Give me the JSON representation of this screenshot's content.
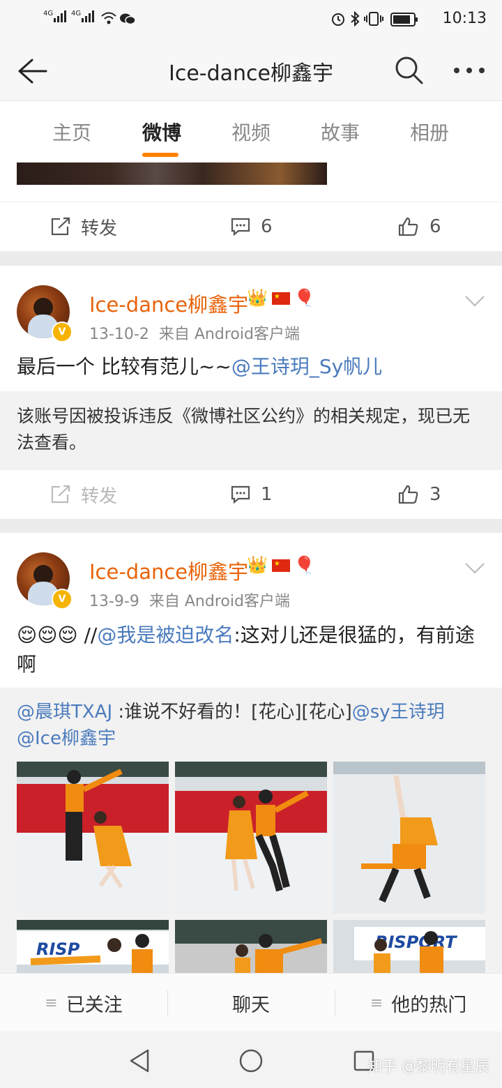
{
  "status_bar": {
    "signal_1": "4G",
    "signal_2": "4G",
    "time": "10:13"
  },
  "nav": {
    "title": "Ice-dance柳鑫宇"
  },
  "tabs": [
    {
      "label": "主页"
    },
    {
      "label": "微博"
    },
    {
      "label": "视频"
    },
    {
      "label": "故事"
    },
    {
      "label": "相册"
    }
  ],
  "active_tab": "微博",
  "accent_color": "#ff8200",
  "post0": {
    "repost_label": "转发",
    "comments": "6",
    "likes": "6"
  },
  "post1": {
    "user": "Ice-dance柳鑫宇",
    "date": "13-10-2",
    "source": "来自 Android客户端",
    "text": "最后一个 比较有范儿~~",
    "mention": "@王诗玥_Sy帆儿",
    "repost_notice": "该账号因被投诉违反《微博社区公约》的相关规定，现已无法查看。",
    "repost_label": "转发",
    "comments": "1",
    "likes": "3"
  },
  "post2": {
    "user": "Ice-dance柳鑫宇",
    "date": "13-9-9",
    "source": "来自 Android客户端",
    "emojis": "😌😌😌",
    "text_prefix": " //",
    "mention": "@我是被迫改名",
    "text": ":这对儿还是很猛的，有前途啊",
    "repost_mention": "@晨琪TXAJ",
    "repost_text": " :谁说不好看的！[花心][花心]",
    "repost_mention_2": "@sy王诗玥",
    "repost_mention_3": "@Ice柳鑫宇",
    "photos": [
      "figure-skating-photo-1",
      "figure-skating-photo-2",
      "figure-skating-photo-3",
      "figure-skating-photo-4",
      "figure-skating-photo-5",
      "figure-skating-photo-6"
    ]
  },
  "badges": [
    "crown-icon",
    "china-flag-icon",
    "balloon-icon"
  ],
  "bottom_bar": {
    "follow": "已关注",
    "chat": "聊天",
    "hot": "他的热门",
    "menu_glyph": "≡"
  },
  "watermark": "知乎 @黎明有星辰"
}
